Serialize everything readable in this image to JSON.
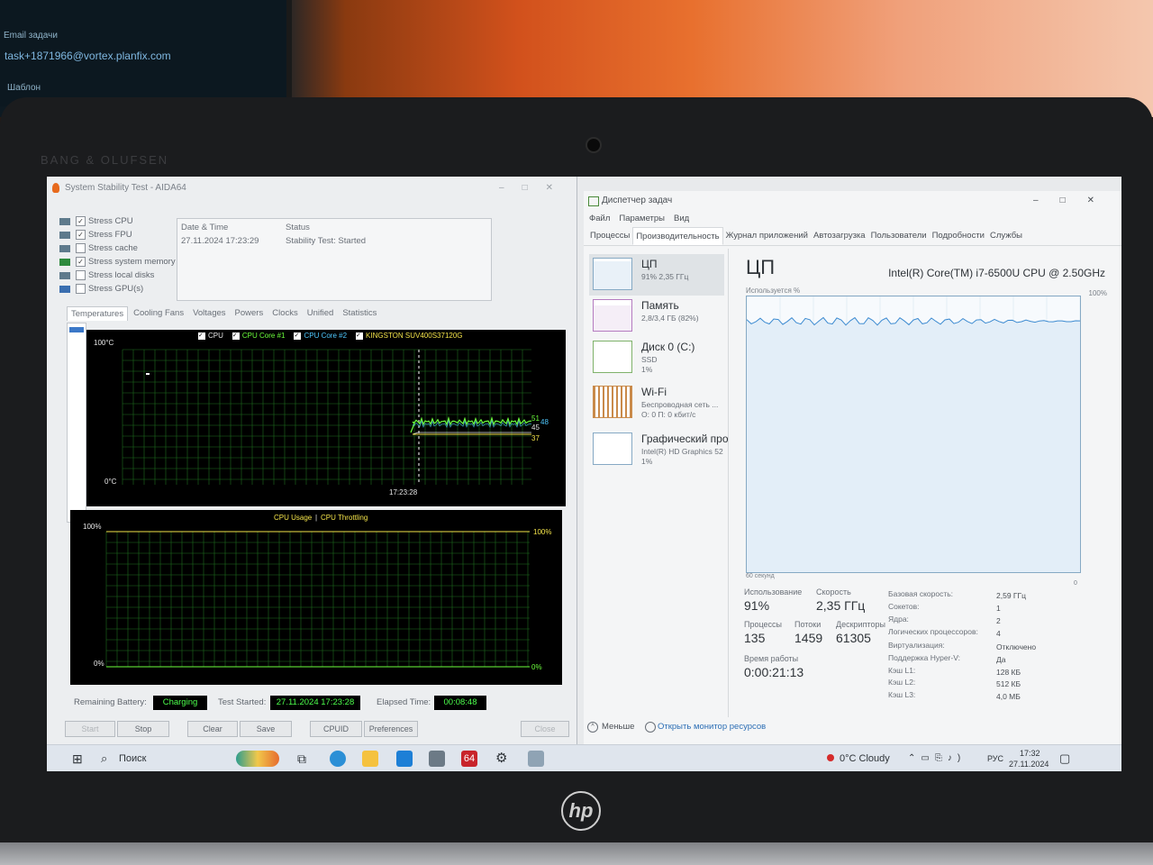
{
  "background": {
    "monitor_line1": "Email задачи",
    "email": "task+1871966@vortex.planfix.com",
    "monitor_line2": "Шаблон",
    "brand": "BANG & OLUFSEN",
    "laptop_logo": "hp"
  },
  "aida": {
    "title": "System Stability Test - AIDA64",
    "stress_items": [
      {
        "label": "Stress CPU",
        "checked": true
      },
      {
        "label": "Stress FPU",
        "checked": true
      },
      {
        "label": "Stress cache",
        "checked": false
      },
      {
        "label": "Stress system memory",
        "checked": true
      },
      {
        "label": "Stress local disks",
        "checked": false
      },
      {
        "label": "Stress GPU(s)",
        "checked": false
      }
    ],
    "status_table": {
      "col_date": "Date & Time",
      "col_status": "Status",
      "date": "27.11.2024 17:23:29",
      "status": "Stability Test: Started"
    },
    "tabs": [
      "Temperatures",
      "Cooling Fans",
      "Voltages",
      "Powers",
      "Clocks",
      "Unified",
      "Statistics"
    ],
    "temp_chart": {
      "legend": [
        "CPU",
        "CPU Core #1",
        "CPU Core #2",
        "KINGSTON SUV400S37120G"
      ],
      "ymax_label": "100°C",
      "ymin_label": "0°C",
      "time_label": "17:23:28",
      "end_labels": [
        "51",
        "48",
        "45",
        "37"
      ]
    },
    "usage_chart": {
      "title_left": "CPU Usage",
      "separator": "|",
      "title_right": "CPU Throttling",
      "ymax_label": "100%",
      "ymin_label": "0%",
      "right_top": "100%",
      "right_bottom": "0%"
    },
    "bottom": {
      "battery_label": "Remaining Battery:",
      "battery_value": "Charging",
      "started_label": "Test Started:",
      "started_value": "27.11.2024 17:23:28",
      "elapsed_label": "Elapsed Time:",
      "elapsed_value": "00:08:48"
    },
    "buttons": {
      "start": "Start",
      "stop": "Stop",
      "clear": "Clear",
      "save": "Save",
      "cpuid": "CPUID",
      "preferences": "Preferences",
      "close": "Close"
    }
  },
  "taskmgr": {
    "title": "Диспетчер задач",
    "menu": [
      "Файл",
      "Параметры",
      "Вид"
    ],
    "tabs": [
      "Процессы",
      "Производительность",
      "Журнал приложений",
      "Автозагрузка",
      "Пользователи",
      "Подробности",
      "Службы"
    ],
    "resources": [
      {
        "name": "ЦП",
        "sub1": "91% 2,35 ГГц",
        "sub2": ""
      },
      {
        "name": "Память",
        "sub1": "2,8/3,4 ГБ (82%)",
        "sub2": ""
      },
      {
        "name": "Диск 0 (C:)",
        "sub1": "SSD",
        "sub2": "1%"
      },
      {
        "name": "Wi-Fi",
        "sub1": "Беспроводная сеть ...",
        "sub2": "О: 0 П: 0 кбит/с"
      },
      {
        "name": "Графический про",
        "sub1": "Intel(R) HD Graphics 52",
        "sub2": "1%"
      }
    ],
    "main_title": "ЦП",
    "cpu_model": "Intel(R) Core(TM) i7-6500U CPU @ 2.50GHz",
    "util_label": "Используется %",
    "pct_max": "100%",
    "time_label": "60 секунд",
    "zero": "0",
    "cpu_usage_percent": 91,
    "stats": {
      "usage_label": "Использование",
      "usage": "91%",
      "speed_label": "Скорость",
      "speed": "2,35 ГГц",
      "proc_label": "Процессы",
      "proc": "135",
      "threads_label": "Потоки",
      "threads": "1459",
      "handles_label": "Дескрипторы",
      "handles": "61305",
      "uptime_label": "Время работы",
      "uptime": "0:00:21:13"
    },
    "specs": [
      {
        "label": "Базовая скорость:",
        "value": "2,59 ГГц"
      },
      {
        "label": "Сокетов:",
        "value": "1"
      },
      {
        "label": "Ядра:",
        "value": "2"
      },
      {
        "label": "Логических процессоров:",
        "value": "4"
      },
      {
        "label": "Виртуализация:",
        "value": "Отключено"
      },
      {
        "label": "Поддержка Hyper-V:",
        "value": "Да"
      },
      {
        "label": "Кэш L1:",
        "value": "128 КБ"
      },
      {
        "label": "Кэш L2:",
        "value": "512 КБ"
      },
      {
        "label": "Кэш L3:",
        "value": "4,0 МБ"
      }
    ],
    "footer": {
      "less": "Меньше",
      "resmon": "Открыть монитор ресурсов"
    }
  },
  "taskbar": {
    "search": "Поиск",
    "weather": "0°C Cloudy",
    "lang": "РУС",
    "time": "17:32",
    "date": "27.11.2024"
  }
}
